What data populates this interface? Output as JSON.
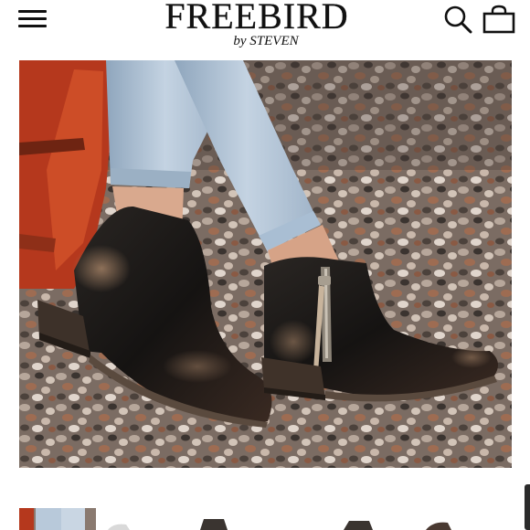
{
  "header": {
    "logo_main": "FREEBIRD",
    "logo_sub": "by STEVEN",
    "menu_icon": "hamburger-menu-icon",
    "search_icon": "search-icon",
    "cart_icon": "shopping-bag-icon"
  },
  "product_image": {
    "alt": "Black distressed leather ankle booties with side zipper worn with light-wash cropped jeans on gravel"
  },
  "thumbnails": {
    "count_visible": 5,
    "active_index": 0
  },
  "colors": {
    "header_bg": "#ffffff",
    "text": "#111111",
    "boot_leather": "#1c1a18",
    "denim": "#a9bed3",
    "gravel": "#8a7a70"
  }
}
